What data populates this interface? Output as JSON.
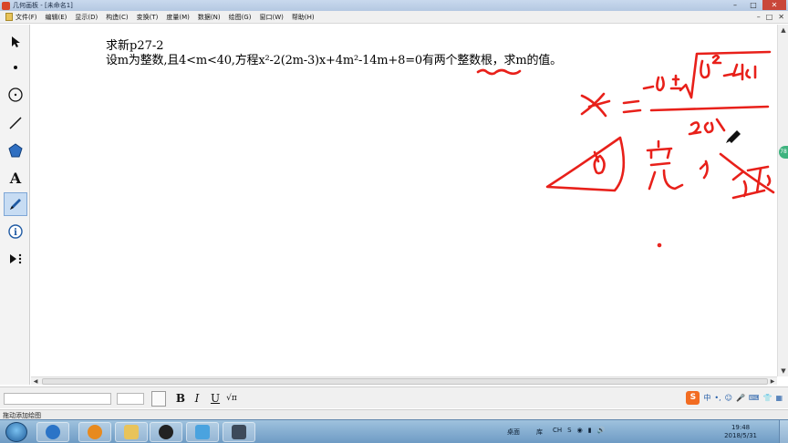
{
  "window": {
    "title": "几何画板 - [未命名1]",
    "controls": [
      "–",
      "□",
      "✕"
    ]
  },
  "menu": {
    "items": [
      "文件(F)",
      "编辑(E)",
      "显示(D)",
      "构造(C)",
      "变换(T)",
      "度量(M)",
      "数据(N)",
      "绘图(G)",
      "窗口(W)",
      "帮助(H)"
    ],
    "mdi_controls": [
      "–",
      "□",
      "✕"
    ]
  },
  "toolbox": {
    "items": [
      {
        "name": "arrow-select-tool",
        "glyph": "↖"
      },
      {
        "name": "point-tool",
        "glyph": "•"
      },
      {
        "name": "compass-tool",
        "glyph": "⊙"
      },
      {
        "name": "straightedge-tool",
        "glyph": "/"
      },
      {
        "name": "polygon-tool",
        "glyph": "⬟"
      },
      {
        "name": "text-tool",
        "glyph": "A"
      },
      {
        "name": "marker-tool",
        "glyph": "✎"
      },
      {
        "name": "information-tool",
        "glyph": "ⓘ"
      },
      {
        "name": "custom-tool",
        "glyph": "▸⋮"
      }
    ]
  },
  "canvas": {
    "problem_title": "求新p27-2",
    "problem_text": "设m为整数,且4<m<40,方程x²-2(2m-3)x+4m²-14m+8=0有两个整数根，求m的值。"
  },
  "format_bar": {
    "bold": "B",
    "italic": "I",
    "underline": "U",
    "math_format": "√π",
    "ime_label": "中",
    "ime_logo": "S"
  },
  "status_bar": {
    "text": "拖动添加绘图"
  },
  "taskbar": {
    "desktop_label": "桌面",
    "library_label": "库",
    "lang": "CH",
    "time": "19:48",
    "date": "2018/5/31"
  },
  "side_badge": "78",
  "colors": {
    "ink_red": "#e8201a",
    "accent_blue": "#245ea8",
    "title_bar": "#b4c8e2"
  }
}
